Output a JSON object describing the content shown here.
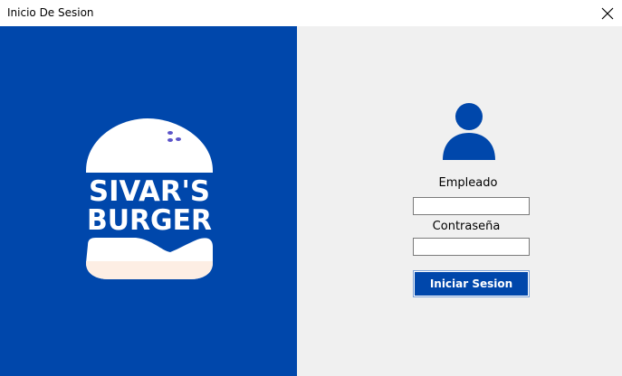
{
  "window": {
    "title": "Inicio De Sesion"
  },
  "brand": {
    "line1": "SIVAR'S",
    "line2": "BURGER"
  },
  "form": {
    "user_label": "Empleado",
    "user_value": "",
    "password_label": "Contraseña",
    "password_value": "",
    "submit_label": "Iniciar Sesion"
  },
  "colors": {
    "brand_blue": "#0047ab",
    "panel_gray": "#f0f0f0",
    "bun_white": "#ffffff"
  }
}
